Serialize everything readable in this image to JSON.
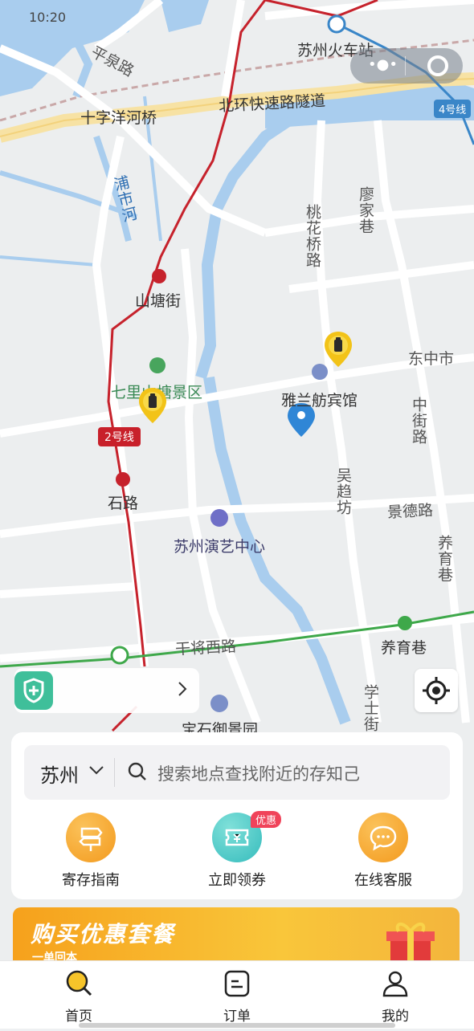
{
  "status_bar": {
    "time": "10:20"
  },
  "map": {
    "labels": {
      "pingquan_road": "平泉路",
      "suzhou_station": "苏州火车站",
      "shizi_bridge": "十字洋河桥",
      "beihuan_tunnel": "北环快速路隧道",
      "pushi_river": "浦市河",
      "liaojia_lane": "廖家巷",
      "taohuaqiao_road": "桃花桥路",
      "shantang_street": "山塘街",
      "dongzhong_market": "东中市",
      "qili_shantang": "七里山塘景区",
      "yalan_hotel": "雅兰舫宾馆",
      "zhongjie_road": "中街路",
      "shilu": "石路",
      "wuqu_fang": "吴趋坊",
      "jingde_road": "景德路",
      "performing_arts": "苏州演艺中心",
      "yangyu_lane_v": "养育巷",
      "ganjiang_west": "干将西路",
      "yangyu_lane": "养育巷",
      "xueshi_street": "学士街",
      "baoshi_garden": "宝石御景园"
    },
    "metro_line4": "4号线",
    "metro_line2": "2号线"
  },
  "capsule": {
    "more_icon": "more-dots-icon",
    "close_icon": "target-circle-icon"
  },
  "search": {
    "city": "苏州",
    "placeholder": "搜索地点查找附近的存知己"
  },
  "shortcuts": [
    {
      "label": "寄存指南",
      "icon": "signpost-icon",
      "color": "#f6a42a"
    },
    {
      "label": "立即领券",
      "icon": "coupon-icon",
      "color": "#3fc3c0",
      "badge": "优惠"
    },
    {
      "label": "在线客服",
      "icon": "chat-bubble-icon",
      "color": "#f6a42a"
    }
  ],
  "banner": {
    "title": "购买优惠套餐",
    "subtitle": "一单回本"
  },
  "tabs": [
    {
      "label": "首页",
      "icon": "home-search-icon",
      "active": true
    },
    {
      "label": "订单",
      "icon": "order-icon",
      "active": false
    },
    {
      "label": "我的",
      "icon": "profile-icon",
      "active": false
    }
  ]
}
